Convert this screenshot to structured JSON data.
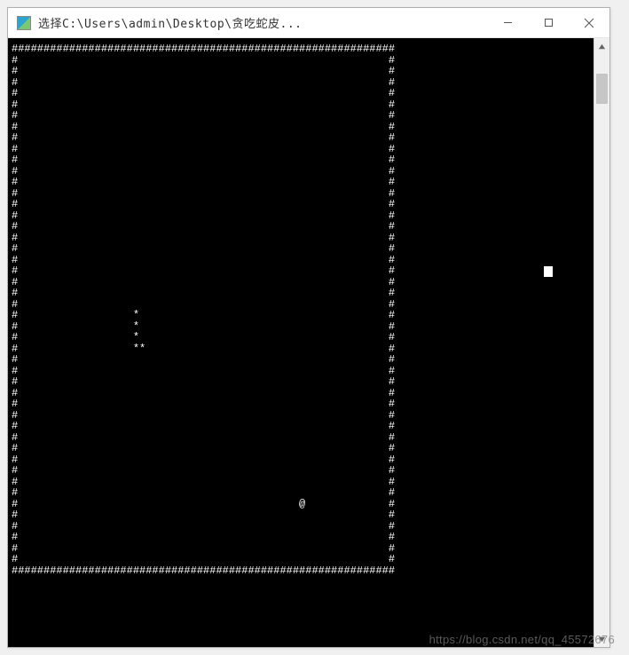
{
  "window": {
    "title": "选择C:\\Users\\admin\\Desktop\\贪吃蛇皮..."
  },
  "game": {
    "boardCols": 60,
    "boardRows": 48,
    "wallChar": "#",
    "emptyChar": " ",
    "snakeChar": "*",
    "foodChar": "@",
    "snake": [
      {
        "col": 19,
        "row": 24
      },
      {
        "col": 19,
        "row": 25
      },
      {
        "col": 19,
        "row": 26
      },
      {
        "col": 19,
        "row": 27
      },
      {
        "col": 20,
        "row": 27
      }
    ],
    "food": {
      "col": 45,
      "row": 41
    },
    "cursor": {
      "xPx": 604,
      "yPx": 257
    }
  },
  "watermark": "https://blog.csdn.net/qq_45572676"
}
